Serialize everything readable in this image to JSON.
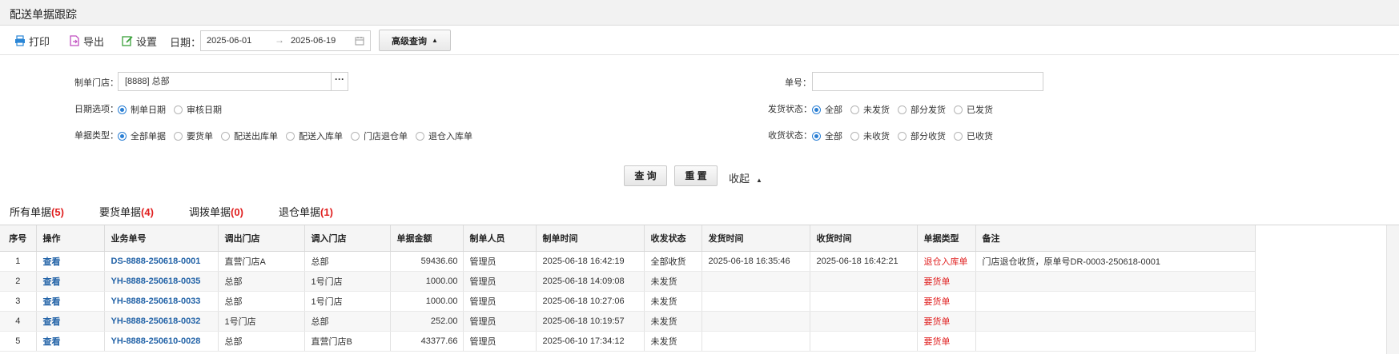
{
  "title": "配送单据跟踪",
  "toolbar": {
    "print_label": "打印",
    "export_label": "导出",
    "settings_label": "设置",
    "date_label": "日期：",
    "date_from": "2025-06-01",
    "date_arrow": "→",
    "date_to": "2025-06-19",
    "advanced_label": "高级查询"
  },
  "filters": {
    "store_label": "制单门店：",
    "store_value": "[8888] 总部",
    "store_picker": "···",
    "docno_label": "单号：",
    "docno_value": "",
    "date_option_label": "日期选项：",
    "date_options": [
      {
        "label": "制单日期",
        "checked": true
      },
      {
        "label": "审核日期",
        "checked": false
      }
    ],
    "doc_type_label": "单据类型：",
    "doc_types": [
      {
        "label": "全部单据",
        "checked": true
      },
      {
        "label": "要货单",
        "checked": false
      },
      {
        "label": "配送出库单",
        "checked": false
      },
      {
        "label": "配送入库单",
        "checked": false
      },
      {
        "label": "门店退仓单",
        "checked": false
      },
      {
        "label": "退仓入库单",
        "checked": false
      }
    ],
    "ship_status_label": "发货状态：",
    "ship_status": [
      {
        "label": "全部",
        "checked": true
      },
      {
        "label": "未发货",
        "checked": false
      },
      {
        "label": "部分发货",
        "checked": false
      },
      {
        "label": "已发货",
        "checked": false
      }
    ],
    "recv_status_label": "收货状态：",
    "recv_status": [
      {
        "label": "全部",
        "checked": true
      },
      {
        "label": "未收货",
        "checked": false
      },
      {
        "label": "部分收货",
        "checked": false
      },
      {
        "label": "已收货",
        "checked": false
      }
    ]
  },
  "actions": {
    "query_label": "查 询",
    "reset_label": "重 置",
    "collapse_label": "收起"
  },
  "tabs": [
    {
      "label": "所有单据",
      "count": "(5)"
    },
    {
      "label": "要货单据",
      "count": "(4)"
    },
    {
      "label": "调拨单据",
      "count": "(0)"
    },
    {
      "label": "退仓单据",
      "count": "(1)"
    }
  ],
  "table": {
    "columns": [
      "序号",
      "操作",
      "业务单号",
      "调出门店",
      "调入门店",
      "单据金额",
      "制单人员",
      "制单时间",
      "收发状态",
      "发货时间",
      "收货时间",
      "单据类型",
      "备注"
    ],
    "rows": [
      [
        "1",
        "查看",
        "DS-8888-250618-0001",
        "直营门店A",
        "总部",
        "59436.60",
        "管理员",
        "2025-06-18 16:42:19",
        "全部收货",
        "2025-06-18 16:35:46",
        "2025-06-18 16:42:21",
        "退仓入库单",
        "门店退仓收货，原单号DR-0003-250618-0001"
      ],
      [
        "2",
        "查看",
        "YH-8888-250618-0035",
        "总部",
        "1号门店",
        "1000.00",
        "管理员",
        "2025-06-18 14:09:08",
        "未发货",
        "",
        "",
        "要货单",
        ""
      ],
      [
        "3",
        "查看",
        "YH-8888-250618-0033",
        "总部",
        "1号门店",
        "1000.00",
        "管理员",
        "2025-06-18 10:27:06",
        "未发货",
        "",
        "",
        "要货单",
        ""
      ],
      [
        "4",
        "查看",
        "YH-8888-250618-0032",
        "1号门店",
        "总部",
        "252.00",
        "管理员",
        "2025-06-18 10:19:57",
        "未发货",
        "",
        "",
        "要货单",
        ""
      ],
      [
        "5",
        "查看",
        "YH-8888-250610-0028",
        "总部",
        "直营门店B",
        "43377.66",
        "管理员",
        "2025-06-10 17:34:12",
        "未发货",
        "",
        "",
        "要货单",
        ""
      ]
    ]
  },
  "colors": {
    "accent": "#2a7fd4",
    "link": "#2464a8",
    "count_red": "#e02020",
    "print_icon": "#2a86d6",
    "export_icon": "#c04fc0",
    "settings_icon": "#3aa03a"
  }
}
